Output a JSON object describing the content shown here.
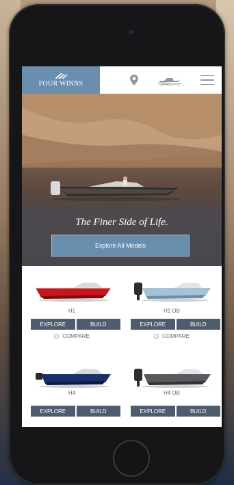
{
  "header": {
    "logo_text": "FOUR WINNS",
    "icons": [
      "location-pin-icon",
      "boat-icon",
      "hamburger-menu-icon"
    ]
  },
  "hero": {
    "tagline": "The Finer Side of Life.",
    "cta_label": "Explore All Models"
  },
  "models": [
    {
      "name": "H1",
      "hull_color": "#c8161d",
      "explore_label": "EXPLORE",
      "build_label": "BUILD",
      "compare_label": "COMPARE"
    },
    {
      "name": "H1 OB",
      "hull_color": "#a6c2d6",
      "explore_label": "EXPLORE",
      "build_label": "BUILD",
      "compare_label": "COMPARE"
    },
    {
      "name": "H4",
      "hull_color": "#1a2f6b",
      "explore_label": "EXPLORE",
      "build_label": "BUILD"
    },
    {
      "name": "H4 OB",
      "hull_color": "#5a5a5e",
      "explore_label": "EXPLORE",
      "build_label": "BUILD"
    }
  ],
  "colors": {
    "brand_blue": "#6a8fae",
    "button_slate": "#4e5c6d"
  }
}
